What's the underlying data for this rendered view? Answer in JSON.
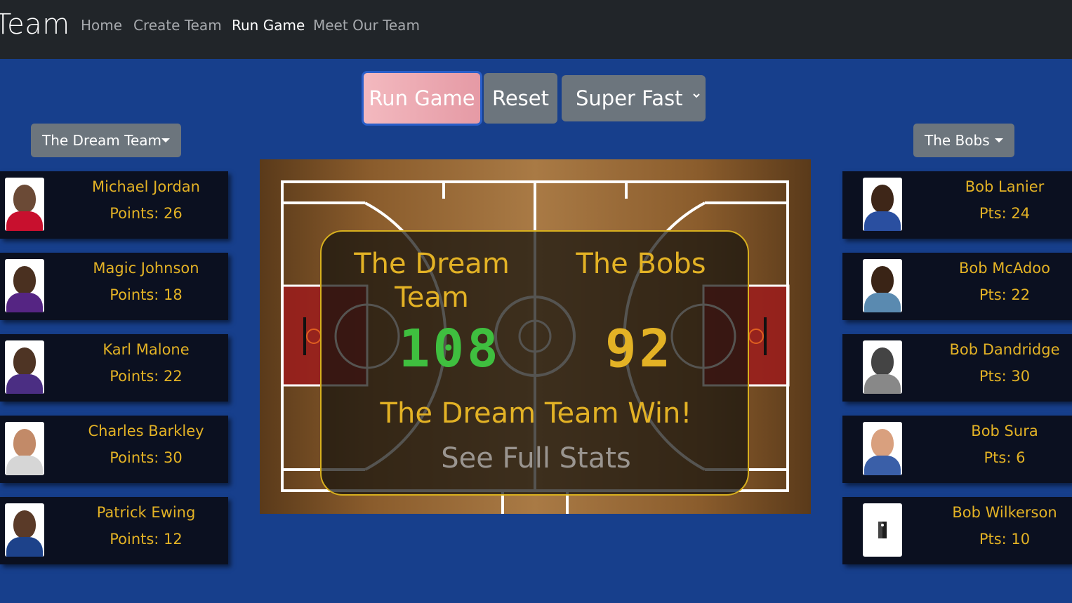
{
  "nav": {
    "brand": "Team",
    "links": [
      "Home",
      "Create Team",
      "Run Game",
      "Meet Our Team"
    ],
    "active": "Run Game"
  },
  "controls": {
    "run_label": "Run Game",
    "reset_label": "Reset",
    "speed_selected": "Super Fast"
  },
  "home_team": {
    "name": "The Dream Team",
    "players": [
      {
        "name": "Michael Jordan",
        "points": "Points: 26"
      },
      {
        "name": "Magic Johnson",
        "points": "Points: 18"
      },
      {
        "name": "Karl Malone",
        "points": "Points: 22"
      },
      {
        "name": "Charles Barkley",
        "points": "Points: 30"
      },
      {
        "name": "Patrick Ewing",
        "points": "Points: 12"
      }
    ]
  },
  "away_team": {
    "name": "The Bobs",
    "players": [
      {
        "name": "Bob Lanier",
        "points": "Pts: 24"
      },
      {
        "name": "Bob McAdoo",
        "points": "Pts: 22"
      },
      {
        "name": "Bob Dandridge",
        "points": "Pts: 30"
      },
      {
        "name": "Bob Sura",
        "points": "Pts: 6"
      },
      {
        "name": "Bob Wilkerson",
        "points": "Pts: 10"
      }
    ]
  },
  "scoreboard": {
    "home_name": "The Dream Team",
    "away_name": "The Bobs",
    "home_score": "108",
    "away_score": "92",
    "result": "The Dream Team Win!",
    "stats_link": "See Full Stats"
  },
  "colors": {
    "page_bg": "#173f8c",
    "navbar_bg": "#212529",
    "accent_gold": "#e3b225",
    "home_score": "#3fbf3f",
    "button_gray": "#6c757d"
  }
}
